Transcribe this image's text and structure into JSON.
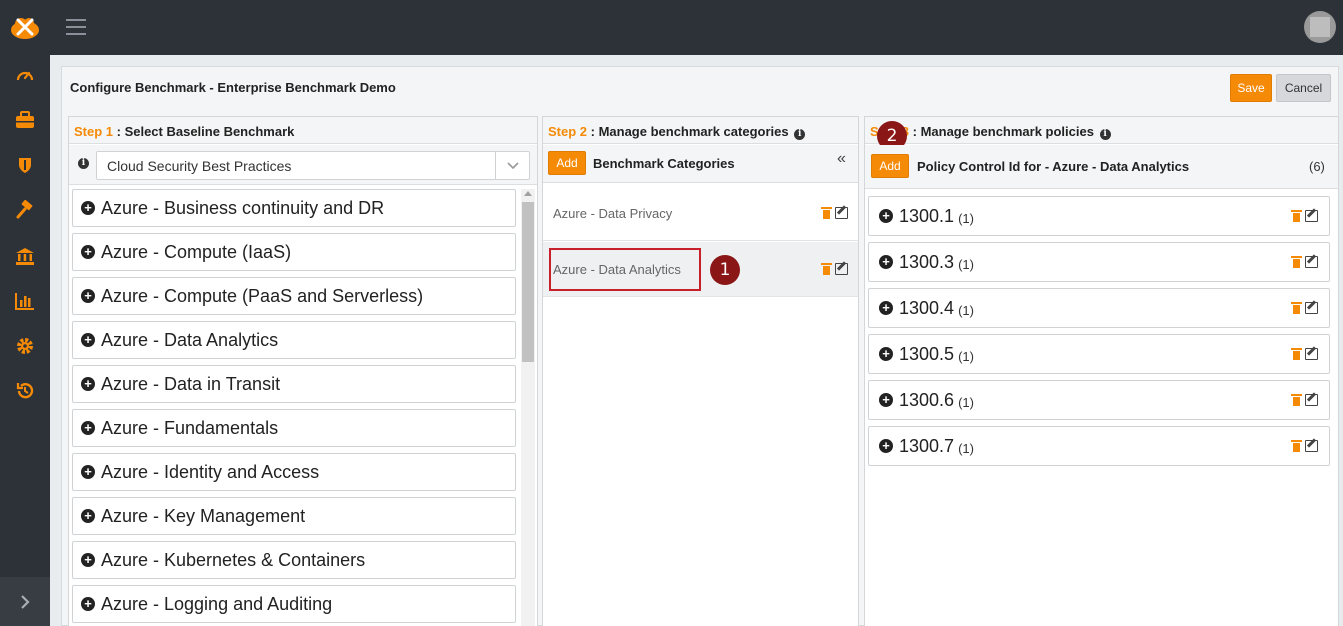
{
  "header": {
    "logo_icon": "logo-icon",
    "menu_icon": "hamburger-icon",
    "avatar_icon": "avatar"
  },
  "sidebar": {
    "items": [
      {
        "icon": "dashboard-icon"
      },
      {
        "icon": "briefcase-icon"
      },
      {
        "icon": "shield-icon"
      },
      {
        "icon": "hammer-icon"
      },
      {
        "icon": "bank-icon"
      },
      {
        "icon": "bar-chart-icon"
      },
      {
        "icon": "gear-icon"
      },
      {
        "icon": "history-icon"
      }
    ],
    "expand_icon": "chevron-right-icon"
  },
  "page": {
    "title": "Configure Benchmark - Enterprise Benchmark Demo",
    "save_label": "Save",
    "cancel_label": "Cancel"
  },
  "step1": {
    "step_label": "Step 1",
    "title": " : Select Baseline Benchmark",
    "selected_baseline": "Cloud Security Best Practices",
    "benchmarks": [
      "Azure - Business continuity and DR",
      "Azure - Compute (IaaS)",
      "Azure - Compute (PaaS and Serverless)",
      "Azure - Data Analytics",
      "Azure - Data in Transit",
      "Azure - Fundamentals",
      "Azure - Identity and Access",
      "Azure - Key Management",
      "Azure - Kubernetes & Containers",
      "Azure - Logging and Auditing"
    ]
  },
  "step2": {
    "step_label": "Step 2",
    "title": " : Manage benchmark categories",
    "add_label": "Add",
    "subtitle": "Benchmark Categories",
    "collapse_glyph": "«",
    "categories": [
      {
        "label": "Azure - Data Privacy",
        "active": false
      },
      {
        "label": "Azure - Data Analytics",
        "active": true
      }
    ],
    "marker": "1"
  },
  "step3": {
    "step_label": "Step 3",
    "title": " : Manage benchmark policies",
    "add_label": "Add",
    "subtitle": "Policy Control Id for - Azure - Data Analytics",
    "count": "(6)",
    "marker": "2",
    "policies": [
      {
        "id": "1300.1",
        "count": "(1)"
      },
      {
        "id": "1300.3",
        "count": "(1)"
      },
      {
        "id": "1300.4",
        "count": "(1)"
      },
      {
        "id": "1300.5",
        "count": "(1)"
      },
      {
        "id": "1300.6",
        "count": "(1)"
      },
      {
        "id": "1300.7",
        "count": "(1)"
      }
    ]
  },
  "colors": {
    "accent": "#f58a07",
    "sidebar_bg": "#2d3238",
    "marker": "#8b1616",
    "highlight": "#c8202a"
  }
}
